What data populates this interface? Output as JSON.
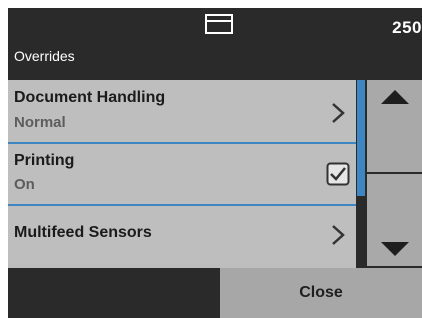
{
  "header": {
    "title": "Overrides",
    "count": "250",
    "tray_icon": "tray-icon"
  },
  "items": [
    {
      "label": "Document Handling",
      "value": "Normal",
      "control": "chevron-right-icon"
    },
    {
      "label": "Printing",
      "value": "On",
      "control": "checkbox-checked",
      "checked": true
    },
    {
      "label": "Multifeed Sensors",
      "control": "chevron-right-icon"
    }
  ],
  "scroll": {
    "up_icon": "triangle-up-icon",
    "down_icon": "triangle-down-icon"
  },
  "footer": {
    "close_label": "Close"
  },
  "colors": {
    "background": "#2a2a2a",
    "item": "#bebebe",
    "accent": "#3e86c2",
    "button": "#a7a7a7"
  }
}
